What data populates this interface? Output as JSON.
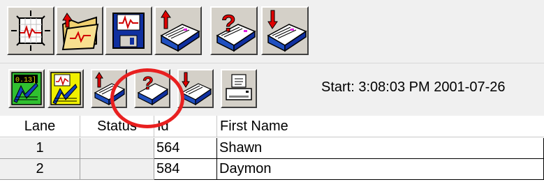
{
  "toolbar_main": {
    "buttons": [
      {
        "name": "monitor",
        "icon": "monitor-chart-icon"
      },
      {
        "name": "open",
        "icon": "open-folder-icon"
      },
      {
        "name": "save",
        "icon": "floppy-disk-icon"
      },
      {
        "name": "upload-cards",
        "icon": "card-file-upload-icon"
      },
      {
        "name": "query-cards",
        "icon": "card-file-query-icon"
      },
      {
        "name": "download-cards",
        "icon": "card-file-download-icon"
      }
    ]
  },
  "toolbar_secondary": {
    "buttons": [
      {
        "name": "timer-results",
        "icon": "timer-results-icon"
      },
      {
        "name": "results-chart",
        "icon": "results-chart-icon"
      },
      {
        "name": "upload-cards",
        "icon": "card-file-upload-icon"
      },
      {
        "name": "query-cards",
        "icon": "card-file-query-icon"
      },
      {
        "name": "download-cards",
        "icon": "card-file-download-icon"
      },
      {
        "name": "print",
        "icon": "printer-icon"
      }
    ],
    "start_text": "Start:  3:08:03 PM 2001-07-26"
  },
  "grid": {
    "columns": [
      "Lane",
      "Status",
      "Id",
      "First Name"
    ],
    "rows": [
      {
        "lane": "1",
        "status": "",
        "id": "564",
        "first_name": "Shawn"
      },
      {
        "lane": "2",
        "status": "",
        "id": "584",
        "first_name": "Daymon"
      }
    ]
  },
  "annotation": {
    "color": "#e82020",
    "shape": "circle"
  },
  "colors": {
    "button_face": "#d4d0c8",
    "window_bg": "#f0f0f0",
    "highlight_red": "#e82020"
  }
}
